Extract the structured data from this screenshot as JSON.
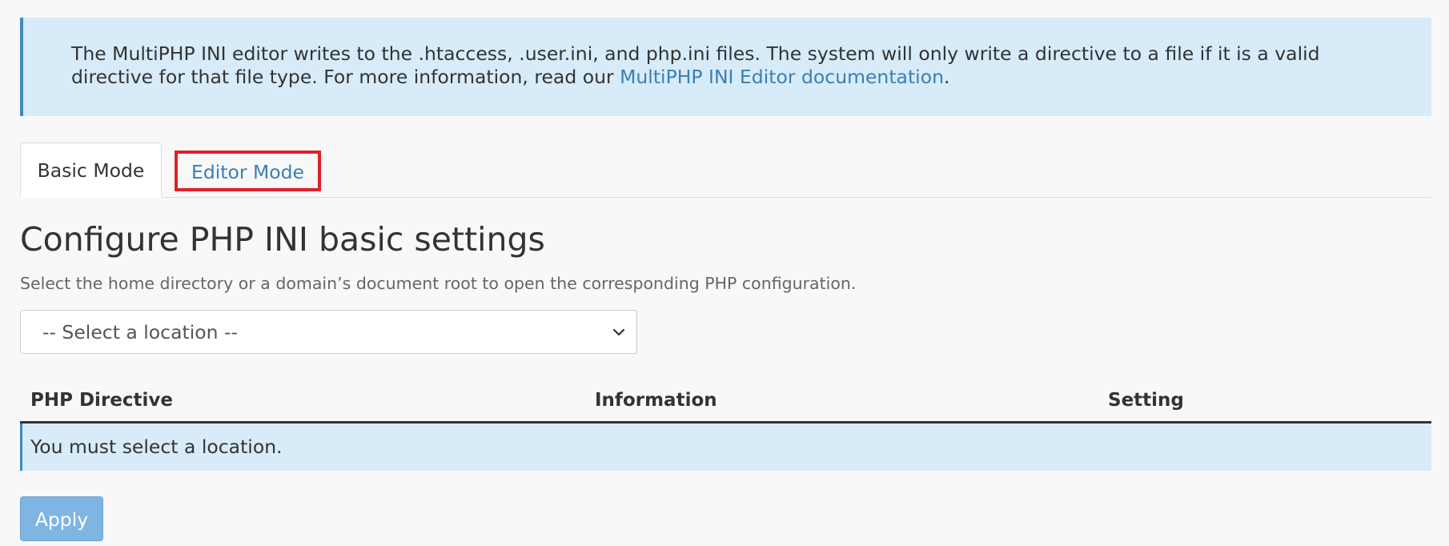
{
  "notice": {
    "text_before": "The MultiPHP INI editor writes to the .htaccess, .user.ini, and php.ini files. The system will only write a directive to a file if it is a valid directive for that file type. For more information, read our ",
    "link": "MultiPHP INI Editor documentation",
    "text_after": "."
  },
  "tabs": [
    {
      "label": "Basic Mode",
      "active": true
    },
    {
      "label": "Editor Mode",
      "active": false
    }
  ],
  "main": {
    "title": "Configure PHP INI basic settings",
    "description": "Select the home directory or a domain’s document root to open the corresponding PHP configuration.",
    "location_select": {
      "selected": "-- Select a location --"
    }
  },
  "table": {
    "headers": [
      "PHP Directive",
      "Information",
      "Setting"
    ],
    "empty_message": "You must select a location."
  },
  "actions": {
    "apply_label": "Apply"
  },
  "colors": {
    "alert_bg": "#d7ebf8",
    "link": "#3b7fb3",
    "highlight_border": "#e0202b",
    "button_bg": "#7fb5e2"
  },
  "icons": {
    "select_toggle": "chevron-down-icon"
  }
}
